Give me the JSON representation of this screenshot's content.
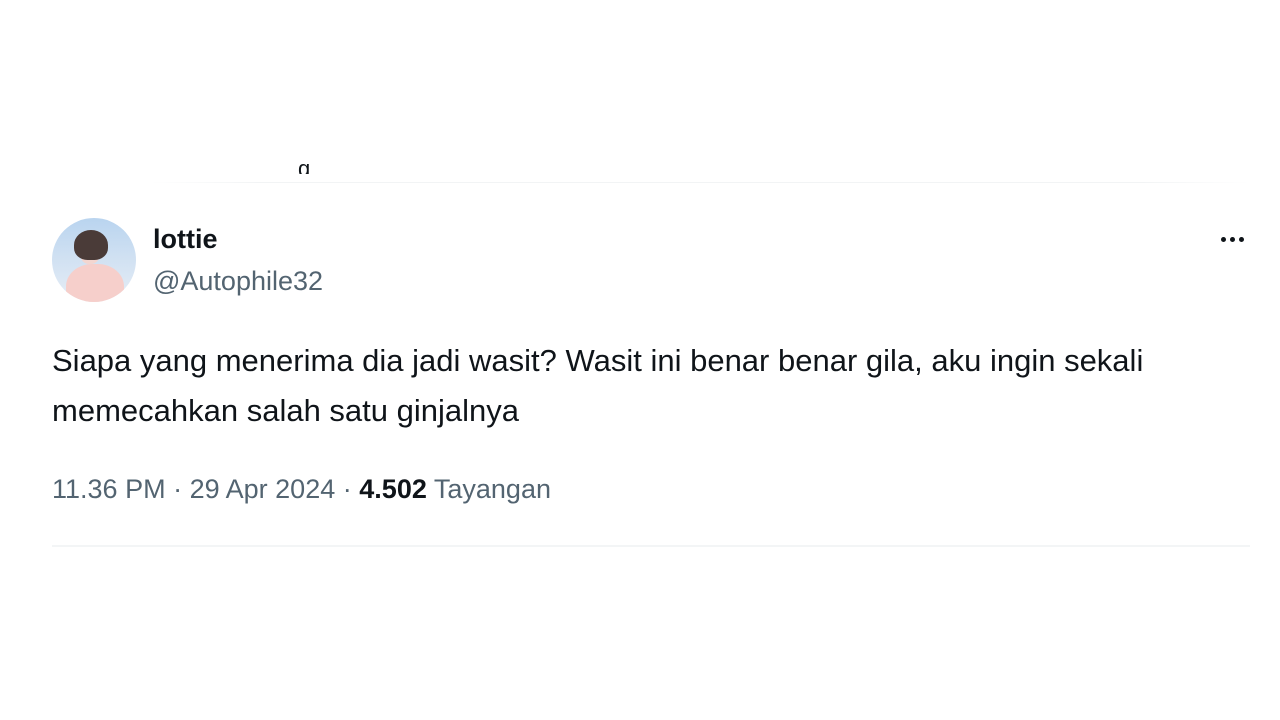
{
  "tweet": {
    "display_name": "lottie",
    "handle": "@Autophile32",
    "text": "Siapa yang menerima dia jadi wasit? Wasit ini benar benar gila, aku ingin sekali memecahkan salah satu ginjalnya",
    "time": "11.36 PM",
    "date": "29 Apr 2024",
    "separator": "·",
    "views_count": "4.502",
    "views_label": "Tayangan",
    "more_icon": "more-horizontal-icon"
  },
  "colors": {
    "text_primary": "#0f1419",
    "text_secondary": "#536471",
    "divider": "#eff3f4",
    "background": "#ffffff"
  }
}
